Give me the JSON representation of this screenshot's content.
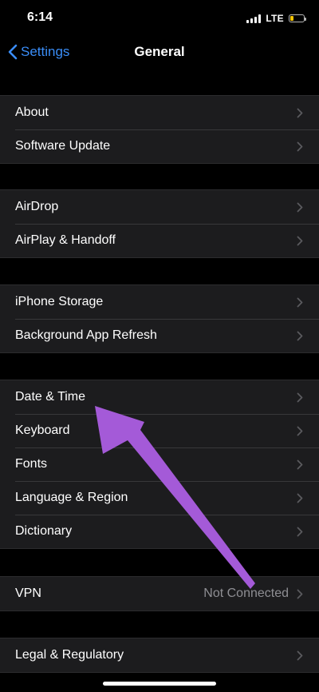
{
  "status_bar": {
    "time": "6:14",
    "network": "LTE",
    "battery_level": 0.25,
    "battery_color": "#f5c400"
  },
  "nav": {
    "back_label": "Settings",
    "title": "General"
  },
  "groups": [
    {
      "items": [
        {
          "label": "About"
        },
        {
          "label": "Software Update"
        }
      ]
    },
    {
      "items": [
        {
          "label": "AirDrop"
        },
        {
          "label": "AirPlay & Handoff"
        }
      ]
    },
    {
      "items": [
        {
          "label": "iPhone Storage"
        },
        {
          "label": "Background App Refresh"
        }
      ]
    },
    {
      "items": [
        {
          "label": "Date & Time"
        },
        {
          "label": "Keyboard"
        },
        {
          "label": "Fonts"
        },
        {
          "label": "Language & Region"
        },
        {
          "label": "Dictionary"
        }
      ]
    },
    {
      "items": [
        {
          "label": "VPN",
          "value": "Not Connected"
        }
      ]
    },
    {
      "items": [
        {
          "label": "Legal & Regulatory"
        }
      ]
    }
  ],
  "theme": {
    "accent": "#3a8df7",
    "cell_background": "#1c1c1e",
    "annotation_arrow": "#a45ad8"
  },
  "icons": {
    "back": "chevron-left-icon",
    "disclosure": "chevron-right-icon",
    "annotation": "arrow-annotation"
  }
}
